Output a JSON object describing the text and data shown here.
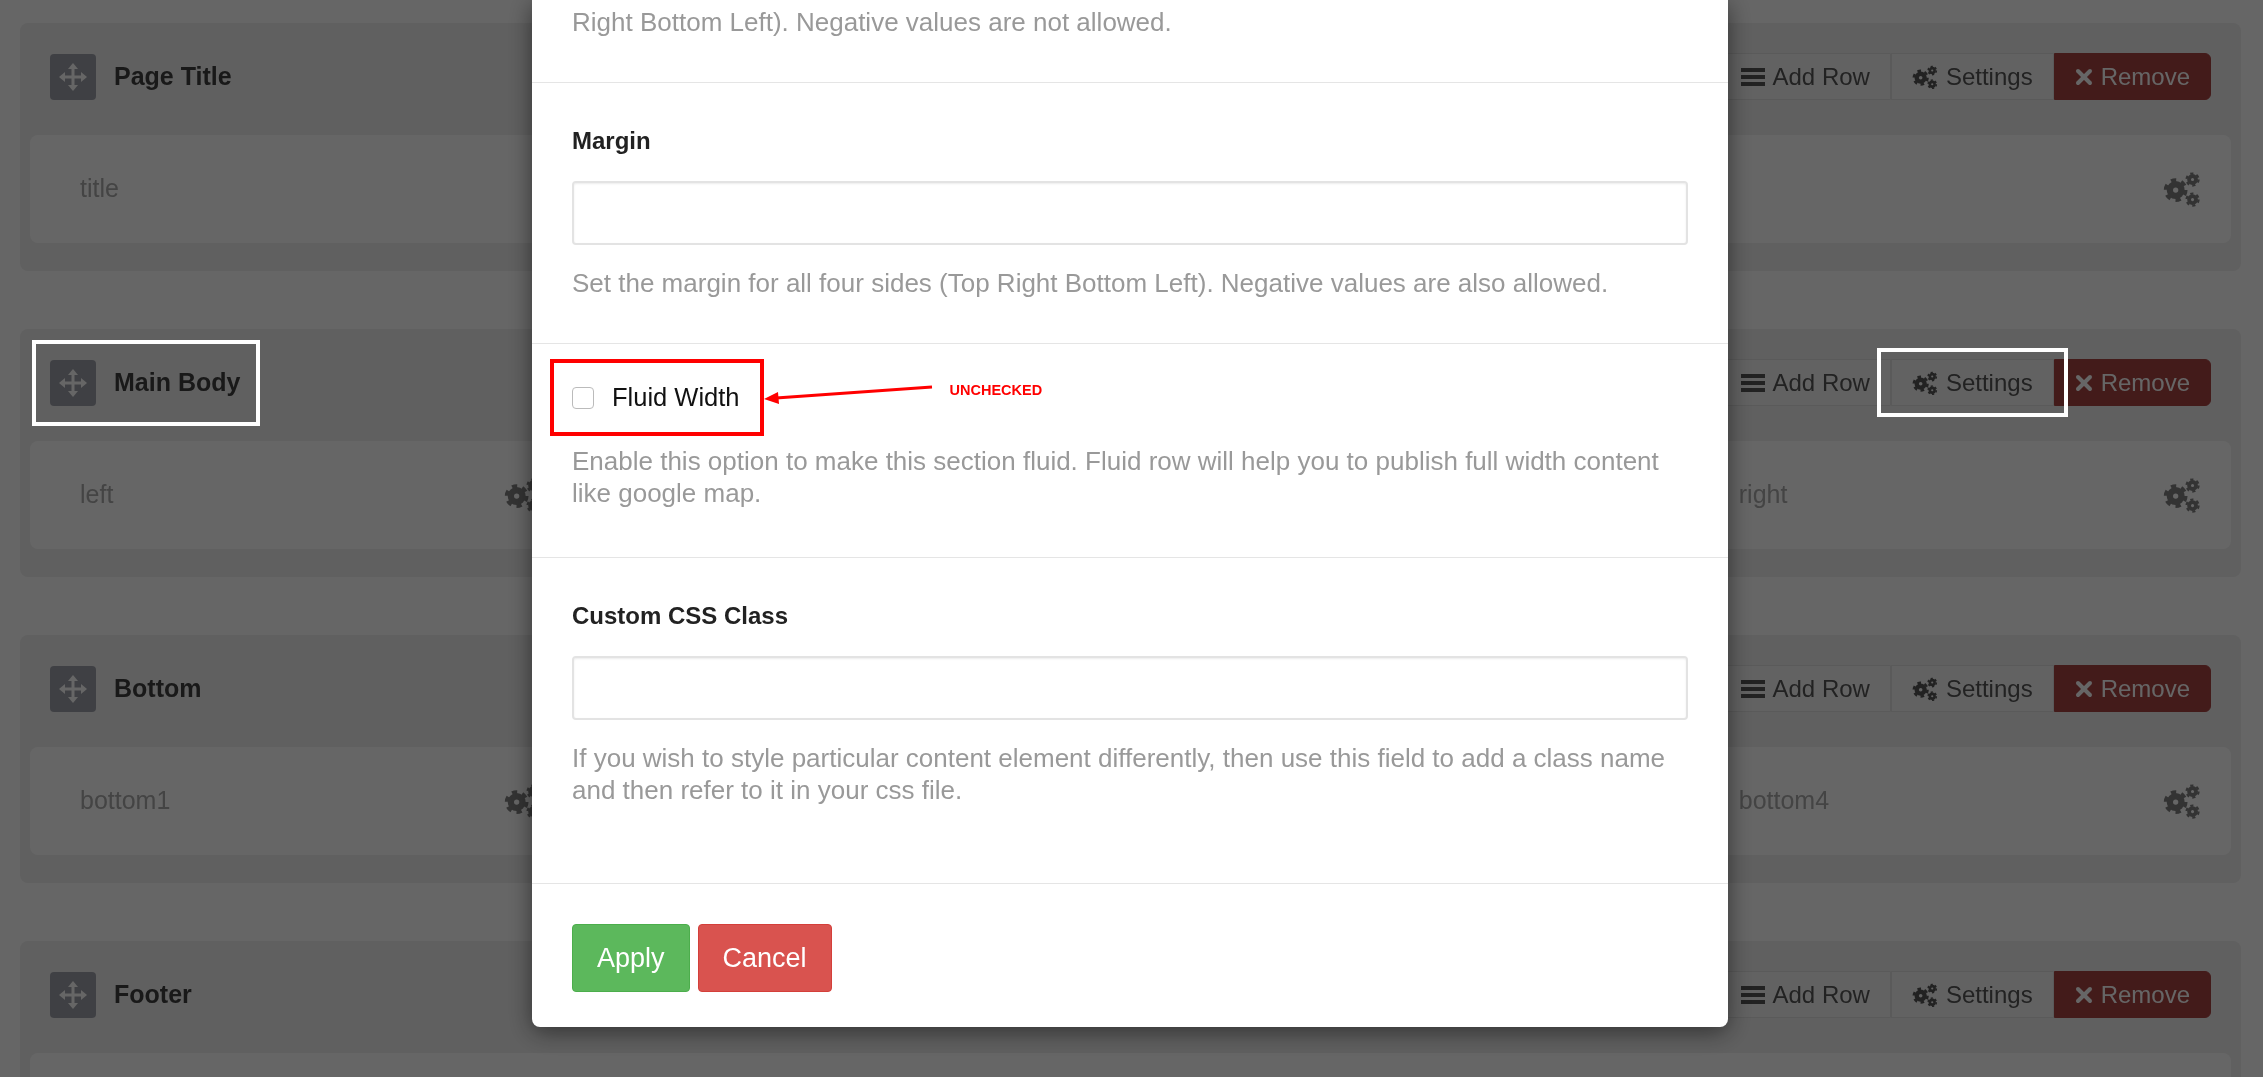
{
  "sections": [
    {
      "title": "Page Title",
      "highlight": false,
      "actions": [
        {
          "label": "Add Row",
          "kind": "add",
          "highlight": false
        },
        {
          "label": "Settings",
          "kind": "settings",
          "highlight": false
        },
        {
          "label": "Remove",
          "kind": "remove",
          "highlight": false
        }
      ],
      "columns": [
        {
          "label": "title"
        }
      ]
    },
    {
      "title": "Main Body",
      "highlight": true,
      "actions": [
        {
          "label": "Add Row",
          "kind": "add",
          "highlight": false
        },
        {
          "label": "Settings",
          "kind": "settings",
          "highlight": true
        },
        {
          "label": "Remove",
          "kind": "remove",
          "highlight": false
        }
      ],
      "columns": [
        {
          "label": "left"
        },
        {
          "label": "right"
        }
      ]
    },
    {
      "title": "Bottom",
      "highlight": false,
      "actions": [
        {
          "label": "Add Row",
          "kind": "add",
          "highlight": false
        },
        {
          "label": "Settings",
          "kind": "settings",
          "highlight": false
        },
        {
          "label": "Remove",
          "kind": "remove",
          "highlight": false
        }
      ],
      "columns": [
        {
          "label": "bottom1"
        },
        {
          "label": "bottom4"
        }
      ]
    },
    {
      "title": "Footer",
      "highlight": false,
      "actions": [
        {
          "label": "Add Row",
          "kind": "add",
          "highlight": false
        },
        {
          "label": "Settings",
          "kind": "settings",
          "highlight": false
        },
        {
          "label": "Remove",
          "kind": "remove",
          "highlight": false
        }
      ]
    }
  ],
  "modal": {
    "top_text": "Right Bottom Left). Negative values are not allowed.",
    "fields": [
      {
        "kind": "text",
        "label": "Margin",
        "help": "Set the margin for all four sides (Top Right Bottom Left). Negative values are also allowed."
      },
      {
        "kind": "checkbox",
        "label": "Fluid Width",
        "checked": false,
        "highlight": true,
        "note": "UNCHECKED",
        "help": "Enable this option to make this section fluid. Fluid row will help you to publish full width content like google map."
      },
      {
        "kind": "text",
        "label": "Custom CSS Class",
        "help": "If you wish to style particular content element differently, then use this field to add a class name and then refer to it in your css file."
      }
    ],
    "buttons": [
      {
        "label": "Apply",
        "kind": "apply"
      },
      {
        "label": "Cancel",
        "kind": "cancel"
      }
    ]
  }
}
